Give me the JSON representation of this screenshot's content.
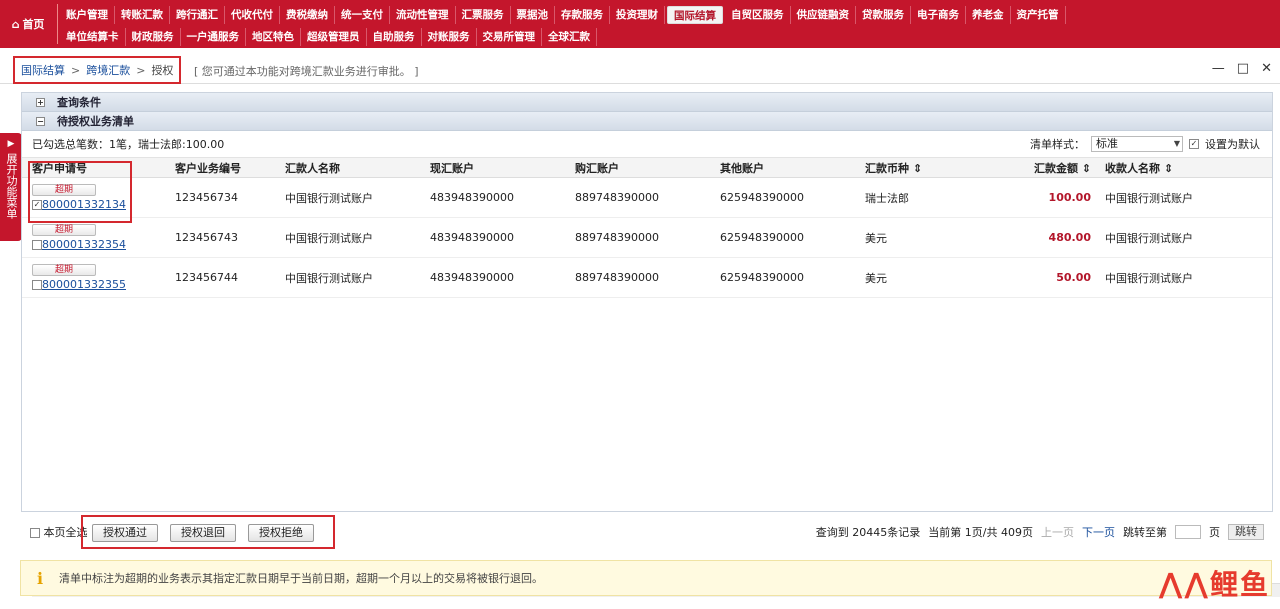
{
  "nav": {
    "home_label": "首页",
    "row1": [
      "账户管理",
      "转账汇款",
      "跨行通汇",
      "代收代付",
      "费税缴纳",
      "统一支付",
      "流动性管理",
      "汇票服务",
      "票据池",
      "存款服务",
      "投资理财",
      "国际结算",
      "自贸区服务",
      "供应链融资",
      "贷款服务",
      "电子商务",
      "养老金",
      "资产托管"
    ],
    "row2": [
      "单位结算卡",
      "财政服务",
      "一户通服务",
      "地区特色",
      "超级管理员",
      "自助服务",
      "对账服务",
      "交易所管理",
      "全球汇款"
    ],
    "active": "国际结算"
  },
  "breadcrumb": {
    "items": [
      "国际结算",
      "跨境汇款",
      "授权"
    ],
    "hint": "[ 您可通过本功能对跨境汇款业务进行审批。 ]"
  },
  "window_controls": [
    "—",
    "□",
    "✕"
  ],
  "side_tab": "展开功能菜单",
  "sections": {
    "query": "查询条件",
    "pending": "待授权业务清单"
  },
  "list_info": {
    "summary": "已勾选总笔数：1笔，瑞士法郎:100.00",
    "style_label": "清单样式：",
    "style_value": "标准",
    "default_label": "设置为默认"
  },
  "table": {
    "headers": [
      "客户申请号",
      "客户业务编号",
      "汇款人名称",
      "现汇账户",
      "购汇账户",
      "其他账户",
      "汇款币种 ⇕",
      "汇款金额 ⇕",
      "收款人名称 ⇕"
    ],
    "overdue_label": "超期",
    "rows": [
      {
        "app_no": "800001332134",
        "biz_no": "123456734",
        "remitter": "中国银行测试账户",
        "spot_acct": "483948390000",
        "purchase_acct": "889748390000",
        "other_acct": "625948390000",
        "currency": "瑞士法郎",
        "amount": "100.00",
        "payee": "中国银行测试账户",
        "checked": true
      },
      {
        "app_no": "800001332354",
        "biz_no": "123456743",
        "remitter": "中国银行测试账户",
        "spot_acct": "483948390000",
        "purchase_acct": "889748390000",
        "other_acct": "625948390000",
        "currency": "美元",
        "amount": "480.00",
        "payee": "中国银行测试账户",
        "checked": false
      },
      {
        "app_no": "800001332355",
        "biz_no": "123456744",
        "remitter": "中国银行测试账户",
        "spot_acct": "483948390000",
        "purchase_acct": "889748390000",
        "other_acct": "625948390000",
        "currency": "美元",
        "amount": "50.00",
        "payee": "中国银行测试账户",
        "checked": false
      }
    ]
  },
  "actions": {
    "select_all": "本页全选",
    "approve": "授权通过",
    "return": "授权退回",
    "reject": "授权拒绝"
  },
  "pager": {
    "total": "查询到 20445条记录",
    "page_info": "当前第 1页/共 409页",
    "prev": "上一页",
    "next": "下一页",
    "jump_label": "跳转至第",
    "page_unit": "页",
    "go": "跳转"
  },
  "notice": "清单中标注为超期的业务表示其指定汇款日期早于当前日期，超期一个月以上的交易将被银行退回。",
  "logo": "鲤鱼",
  "colors": {
    "brand": "#c4162c",
    "link": "#1a4f9c",
    "highlight": "#d4282e"
  }
}
